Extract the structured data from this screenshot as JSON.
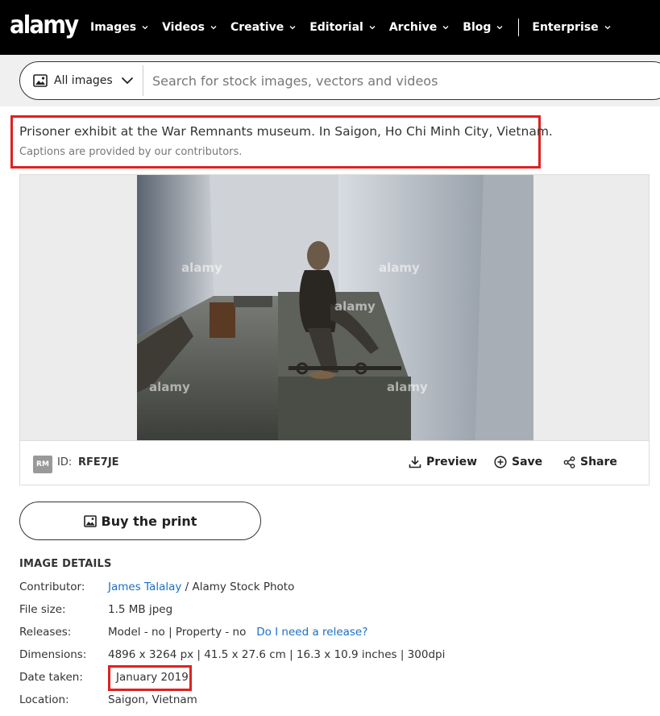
{
  "brand": {
    "logo": "alamy"
  },
  "nav": {
    "items": [
      {
        "label": "Images"
      },
      {
        "label": "Videos"
      },
      {
        "label": "Creative"
      },
      {
        "label": "Editorial"
      },
      {
        "label": "Archive"
      },
      {
        "label": "Blog"
      }
    ],
    "enterprise": "Enterprise"
  },
  "search": {
    "filter_label": "All images",
    "placeholder": "Search for stock images, vectors and videos"
  },
  "caption": {
    "title": "Prisoner exhibit at the War Remnants museum. In Saigon, Ho Chi Minh City, Vietnam.",
    "note": "Captions are provided by our contributors."
  },
  "image": {
    "watermark": "alamy",
    "license_badge": "RM",
    "id_label": "ID:",
    "id_value": "RFE7JE",
    "actions": {
      "preview": "Preview",
      "save": "Save",
      "share": "Share"
    }
  },
  "buy": {
    "label": "Buy the print"
  },
  "details": {
    "heading": "IMAGE DETAILS",
    "contributor": {
      "key": "Contributor:",
      "name": "James Talalay",
      "agency": "/ Alamy Stock Photo"
    },
    "file_size": {
      "key": "File size:",
      "value": "1.5 MB jpeg"
    },
    "releases": {
      "key": "Releases:",
      "value": "Model - no | Property - no",
      "link": "Do I need a release?"
    },
    "dimensions": {
      "key": "Dimensions:",
      "value": "4896 x 3264 px | 41.5 x 27.6 cm | 16.3 x 10.9 inches | 300dpi"
    },
    "date_taken": {
      "key": "Date taken:",
      "value": "January 2019"
    },
    "location": {
      "key": "Location:",
      "value": "Saigon, Vietnam"
    }
  },
  "colors": {
    "accent": "#1a6fc4",
    "highlight": "#e02020",
    "topbar": "#000000"
  }
}
